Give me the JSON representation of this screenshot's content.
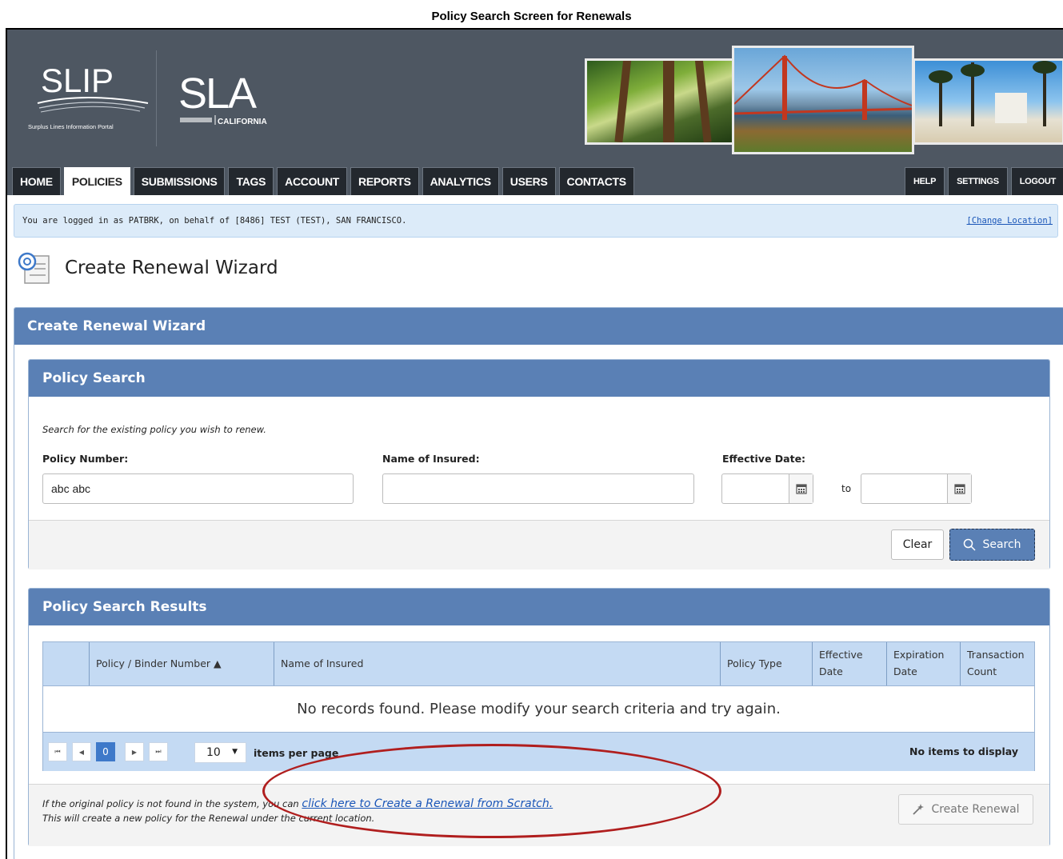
{
  "document_title": "Policy Search Screen for Renewals",
  "logos": {
    "slip_text": "SLIP",
    "slip_tagline": "Surplus Lines Information Portal",
    "sla_text": "SLA",
    "sla_tagline": "CALIFORNIA"
  },
  "nav": {
    "left_tabs": [
      {
        "label": "HOME"
      },
      {
        "label": "POLICIES"
      },
      {
        "label": "SUBMISSIONS"
      },
      {
        "label": "TAGS"
      },
      {
        "label": "ACCOUNT"
      },
      {
        "label": "REPORTS"
      },
      {
        "label": "ANALYTICS"
      },
      {
        "label": "USERS"
      },
      {
        "label": "CONTACTS"
      }
    ],
    "right_tabs": [
      {
        "label": "HELP"
      },
      {
        "label": "SETTINGS"
      },
      {
        "label": "LOGOUT"
      }
    ],
    "active": "POLICIES"
  },
  "login_bar": {
    "text": "You are logged in as PATBRK, on behalf of [8486] TEST (TEST), SAN FRANCISCO.",
    "change_location": "[Change Location]"
  },
  "page_title": "Create Renewal Wizard",
  "wizard": {
    "header": "Create Renewal Wizard",
    "search": {
      "header": "Policy Search",
      "hint": "Search for the existing policy you wish to renew.",
      "policy_number_label": "Policy Number:",
      "policy_number_value": "abc abc",
      "name_label": "Name of Insured:",
      "name_value": "",
      "effective_date_label": "Effective Date:",
      "date_from": "",
      "date_to": "",
      "to_label": "to",
      "clear_label": "Clear",
      "search_label": "Search"
    },
    "results": {
      "header": "Policy Search Results",
      "columns": [
        {
          "label": ""
        },
        {
          "label": "Policy / Binder Number ▲"
        },
        {
          "label": "Name of Insured"
        },
        {
          "label": "Policy Type"
        },
        {
          "label": "Effective Date"
        },
        {
          "label": "Expiration Date"
        },
        {
          "label": "Transaction Count"
        }
      ],
      "empty_message": "No records found. Please modify your search criteria and try again.",
      "pager": {
        "current_page": "0",
        "per_page": "10",
        "per_page_label": "items per page",
        "status": "No items to display"
      },
      "footer": {
        "text_before_link": "If the original policy is not found in the system, you can",
        "link": "click here to Create a Renewal from Scratch.",
        "text_line2": "This will create a new policy for the Renewal under the current location.",
        "create_renewal_label": "Create Renewal"
      }
    }
  },
  "colors": {
    "header_bg": "#4e5762",
    "panel_header": "#5a80b5",
    "grid_header": "#c4daf3",
    "annotation": "#b01e1e"
  }
}
